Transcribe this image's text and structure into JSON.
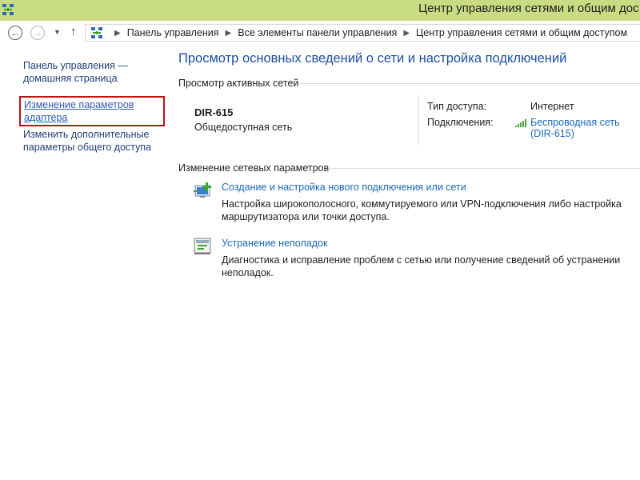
{
  "window": {
    "title": "Центр управления сетями и общим дос"
  },
  "address": {
    "crumbs": [
      "Панель управления",
      "Все элементы панели управления",
      "Центр управления сетями и общим доступом"
    ]
  },
  "sidebar": {
    "items": [
      {
        "line1": "Панель управления —",
        "line2": "домашняя страница"
      },
      {
        "line1": "Изменение параметров",
        "line2": "адаптера"
      },
      {
        "line1": "Изменить дополнительные",
        "line2": "параметры общего доступа"
      }
    ]
  },
  "main": {
    "heading": "Просмотр основных сведений о сети и настройка подключений",
    "active_networks_title": "Просмотр активных сетей",
    "network": {
      "name": "DIR-615",
      "type": "Общедоступная сеть",
      "access_label": "Тип доступа:",
      "access_value": "Интернет",
      "connections_label": "Подключения:",
      "connection_line1": "Беспроводная сеть",
      "connection_line2": "(DIR-615)"
    },
    "change_settings_title": "Изменение сетевых параметров",
    "tasks": [
      {
        "link": "Создание и настройка нового подключения или сети",
        "desc_line1": "Настройка широкополосного, коммутируемого или VPN-подключения либо настройка",
        "desc_line2": "маршрутизатора или точки доступа.",
        "icon": "new-connection-icon"
      },
      {
        "link": "Устранение неполадок",
        "desc_line1": "Диагностика и исправление проблем с сетью или получение сведений об устранении",
        "desc_line2": "неполадок.",
        "icon": "troubleshoot-icon"
      }
    ]
  },
  "colors": {
    "titlebar": "#c9dc84",
    "heading": "#1c4f9e",
    "link": "#1a67b8",
    "selection_border": "#c01414"
  }
}
